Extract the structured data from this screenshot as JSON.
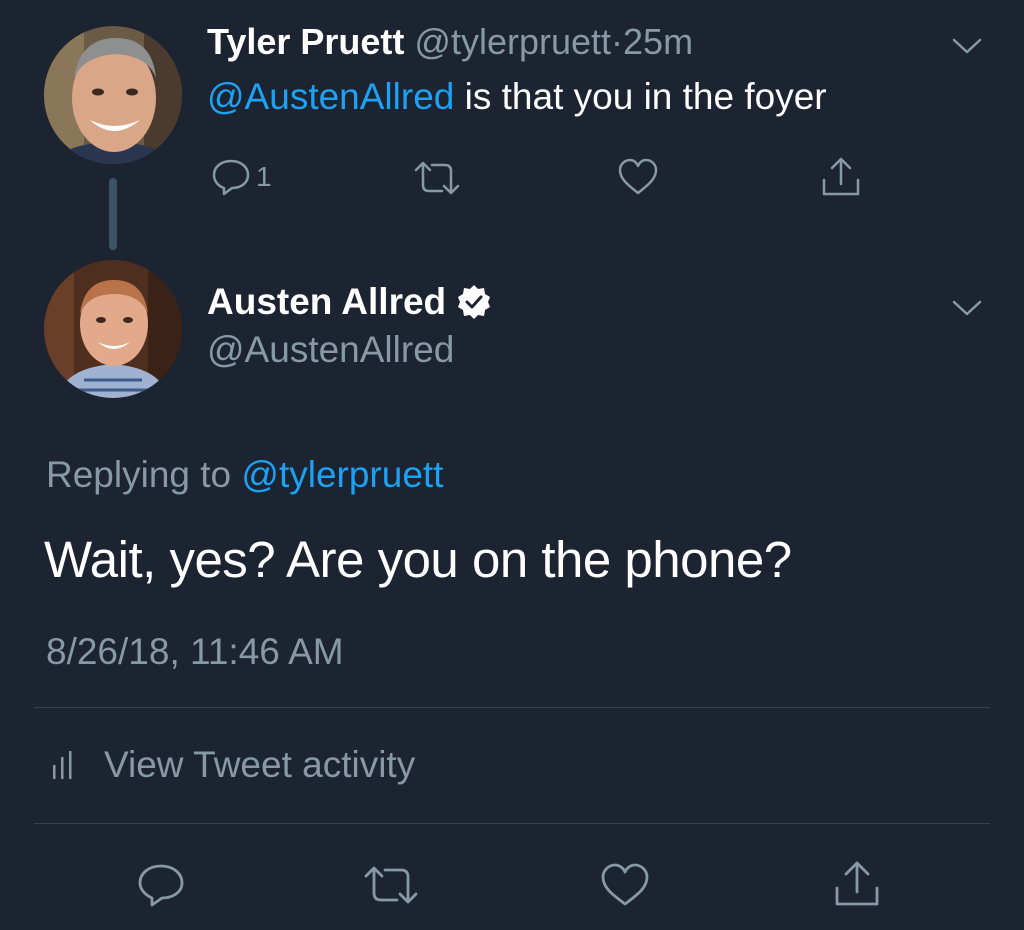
{
  "colors": {
    "background": "#1c2431",
    "text": "#ffffff",
    "secondary": "#8899a6",
    "accent": "#1da1f2",
    "divider": "#38444d"
  },
  "parent_tweet": {
    "name": "Tyler Pruett",
    "handle": "@tylerpruett",
    "separator": "·",
    "time": "25m",
    "mention": "@AustenAllred",
    "text": " is that you in the foyer",
    "reply_count": "1",
    "icons": [
      "reply-icon",
      "retweet-icon",
      "like-icon",
      "share-icon",
      "chevron-down-icon"
    ]
  },
  "main_tweet": {
    "name": "Austen Allred",
    "verified": true,
    "handle": "@AustenAllred",
    "replying_prefix": "Replying to ",
    "replying_mention": "@tylerpruett",
    "text": "Wait, yes? Are you on the phone?",
    "timestamp": "8/26/18, 11:46 AM",
    "activity_label": "View Tweet activity",
    "icons": [
      "verified-badge-icon",
      "chevron-down-icon",
      "bar-chart-icon",
      "reply-icon",
      "retweet-icon",
      "like-icon",
      "share-icon"
    ]
  }
}
